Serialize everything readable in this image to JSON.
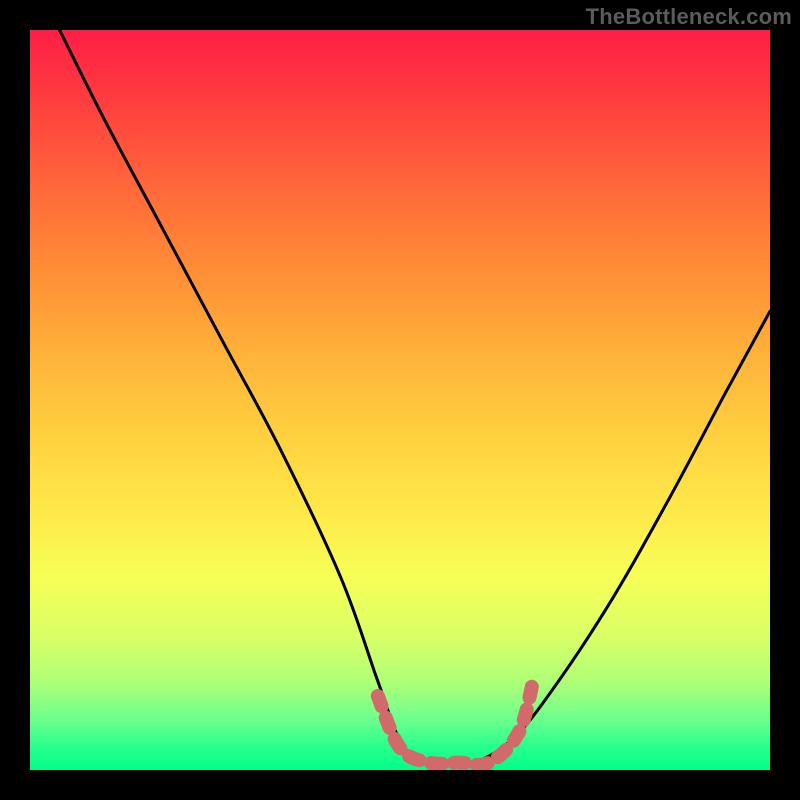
{
  "watermark": "TheBottleneck.com",
  "chart_data": {
    "type": "line",
    "title": "",
    "xlabel": "",
    "ylabel": "",
    "xlim": [
      0,
      100
    ],
    "ylim": [
      0,
      100
    ],
    "grid": false,
    "series": [
      {
        "name": "curve",
        "x": [
          4,
          10,
          18,
          26,
          34,
          42,
          47,
          50,
          53,
          56,
          60,
          65,
          70,
          78,
          86,
          94,
          100
        ],
        "y": [
          100,
          88,
          73,
          58,
          43,
          26,
          12,
          4,
          1,
          1,
          1,
          4,
          10,
          22,
          36,
          51,
          62
        ]
      },
      {
        "name": "optimal-band-marker",
        "x": [
          47,
          50,
          54,
          58,
          62,
          66,
          68
        ],
        "y": [
          10,
          3,
          1,
          1,
          1,
          5,
          12
        ]
      }
    ],
    "background_gradient": {
      "top": "#ff1e46",
      "mid": "#ffe84a",
      "bottom": "#00ff88"
    },
    "marker_color": "#d16a6a"
  }
}
